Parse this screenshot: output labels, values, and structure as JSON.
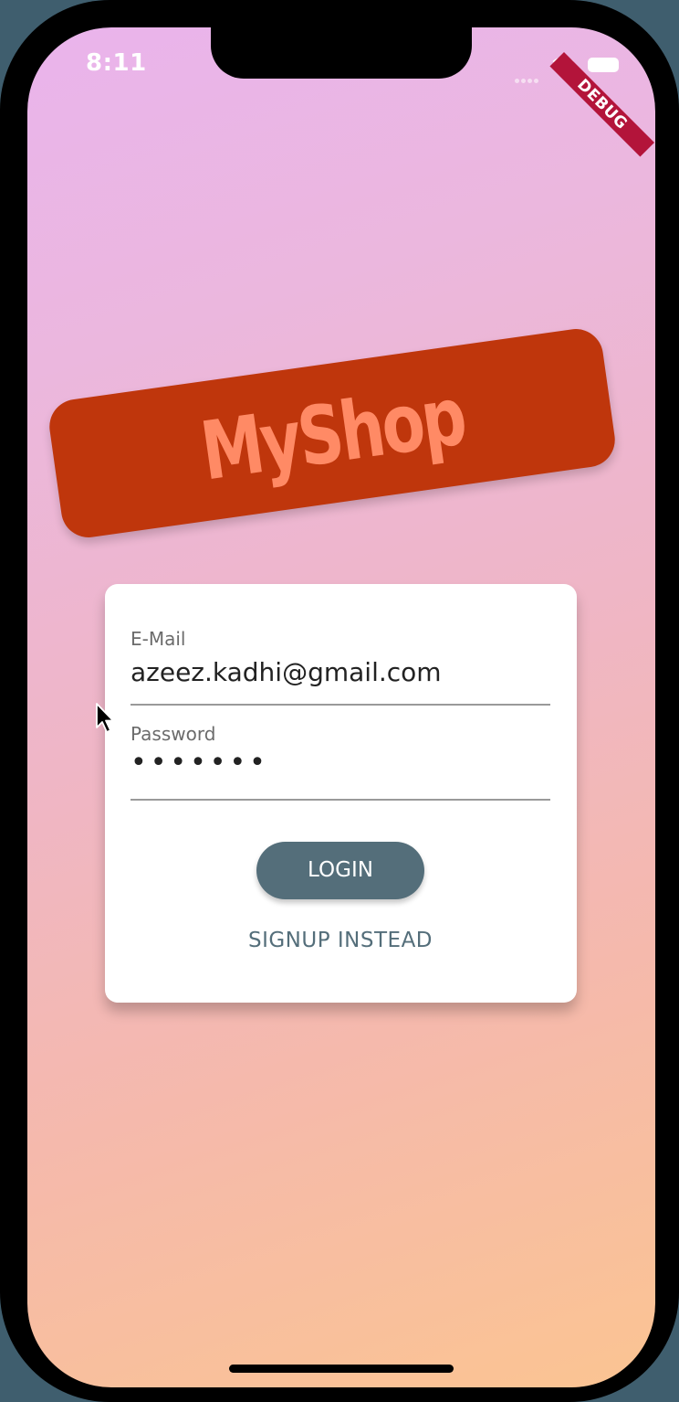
{
  "status_bar": {
    "time": "8:11",
    "debug_banner": "DEBUG"
  },
  "logo": {
    "text": "MyShop",
    "badge_color": "#bf360c",
    "text_color": "#ff8a65"
  },
  "auth_form": {
    "email": {
      "label": "E-Mail",
      "value": "azeez.kadhi@gmail.com"
    },
    "password": {
      "label": "Password",
      "masked_value": "•••••••"
    },
    "login_label": "LOGIN",
    "signup_label": "SIGNUP INSTEAD"
  },
  "colors": {
    "primary": "#546e7a",
    "gradient_top": "#eab4ec",
    "gradient_bottom": "#fbc492"
  }
}
